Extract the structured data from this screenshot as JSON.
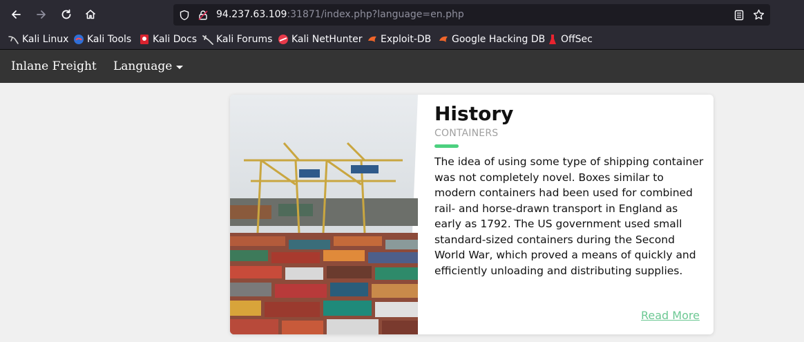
{
  "browser": {
    "url_host": "94.237.63.109",
    "url_rest": ":31871/index.php?language=en.php",
    "icons": [
      "back-icon",
      "forward-icon",
      "reload-icon",
      "home-icon",
      "shield-icon",
      "insecure-lock-icon",
      "reader-view-icon",
      "bookmark-star-icon"
    ]
  },
  "bookmarks": [
    {
      "label": "Kali Linux",
      "icon": "kali-dragon-icon"
    },
    {
      "label": "Kali Tools",
      "icon": "kali-tools-icon"
    },
    {
      "label": "Kali Docs",
      "icon": "kali-docs-icon"
    },
    {
      "label": "Kali Forums",
      "icon": "kali-forums-icon"
    },
    {
      "label": "Kali NetHunter",
      "icon": "nethunter-icon"
    },
    {
      "label": "Exploit-DB",
      "icon": "exploit-db-icon"
    },
    {
      "label": "Google Hacking DB",
      "icon": "ghdb-icon"
    },
    {
      "label": "OffSec",
      "icon": "offsec-icon"
    }
  ],
  "site": {
    "brand": "Inlane Freight",
    "language_menu": "Language"
  },
  "card": {
    "title": "History",
    "subtitle": "CONTAINERS",
    "description": "The idea of using some type of shipping container was not completely novel. Boxes similar to modern containers had been used for combined rail- and horse-drawn transport in England as early as 1792. The US government used small standard-sized containers during the Second World War, which proved a means of quickly and efficiently unloading and distributing supplies.",
    "read_more": "Read More",
    "image": "container-port-photo"
  },
  "colors": {
    "browser_chrome": "#2b2a33",
    "navbar": "#343434",
    "accent": "#4cd07f",
    "link": "#6cc893"
  }
}
